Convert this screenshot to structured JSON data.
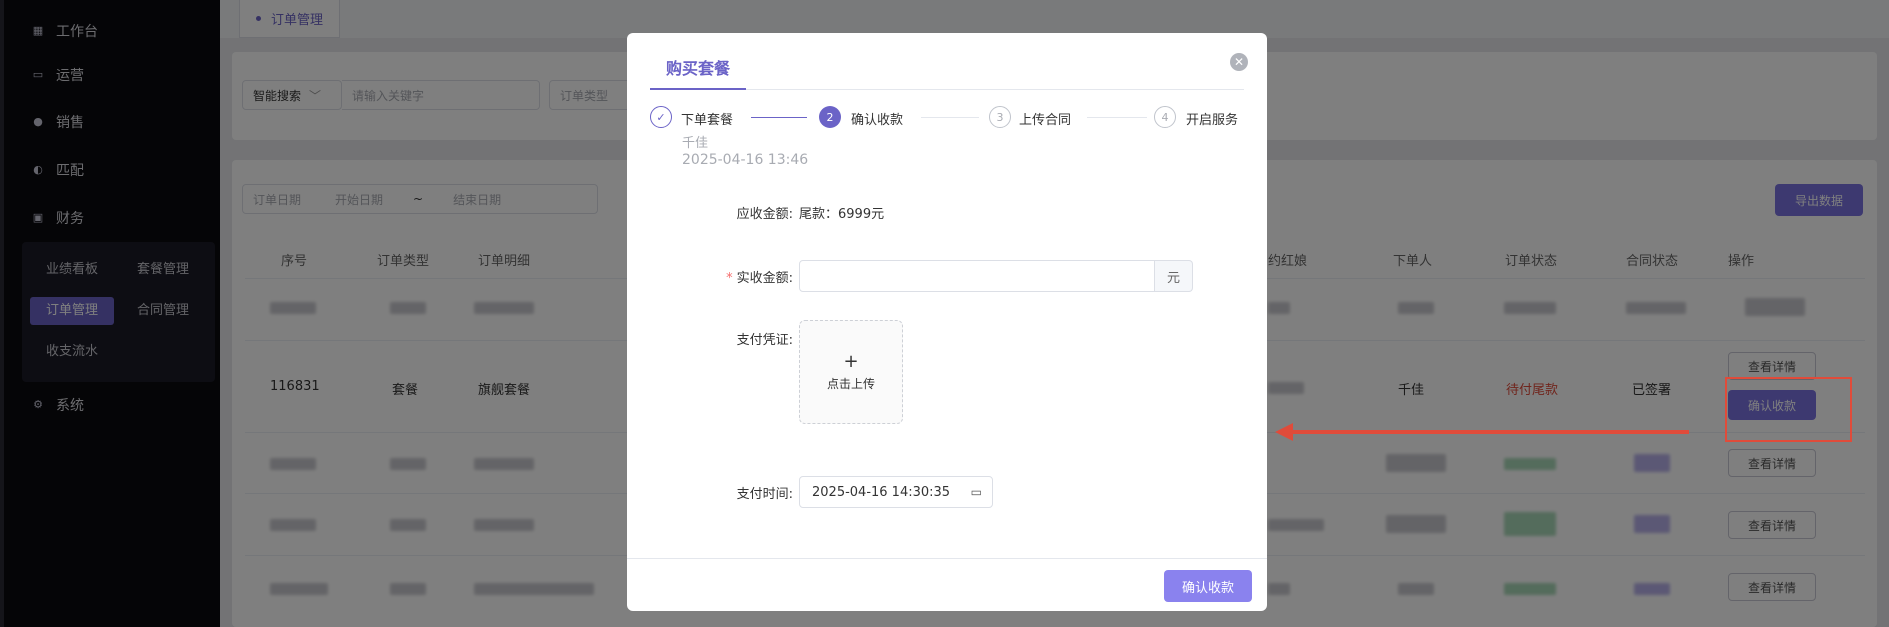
{
  "sidebar": {
    "items": [
      {
        "label": "工作台",
        "icon": "grid-icon"
      },
      {
        "label": "运营",
        "icon": "monitor-icon"
      },
      {
        "label": "销售",
        "icon": "user-icon"
      },
      {
        "label": "匹配",
        "icon": "match-icon"
      },
      {
        "label": "财务",
        "icon": "finance-icon"
      },
      {
        "label": "系统",
        "icon": "system-icon"
      }
    ],
    "sub_items": [
      {
        "label": "业绩看板"
      },
      {
        "label": "套餐管理"
      },
      {
        "label": "订单管理"
      },
      {
        "label": "合同管理"
      },
      {
        "label": "收支流水"
      }
    ]
  },
  "tabs": {
    "active_tab": "订单管理"
  },
  "search": {
    "smart_search_label": "智能搜索",
    "keyword_placeholder": "请输入关键字",
    "order_type_placeholder": "订单类型",
    "order_date_label": "订单日期",
    "start_date_placeholder": "开始日期",
    "date_separator": "~",
    "end_date_placeholder": "结束日期",
    "export_label": "导出数据"
  },
  "table": {
    "headers": [
      "序号",
      "订单类型",
      "订单明细",
      "约红娘",
      "下单人",
      "订单状态",
      "合同状态",
      "操作"
    ],
    "visible_row": {
      "id": "116831",
      "type": "套餐",
      "detail": "旗舰套餐",
      "orderer": "千佳",
      "order_status": "待付尾款",
      "contract_status": "已签署",
      "detail_button": "查看详情",
      "confirm_button": "确认收款"
    },
    "row_action_label": "查看详情",
    "status_color": "#e04b3a"
  },
  "modal": {
    "title": "购买套餐",
    "steps": [
      {
        "index": "✓",
        "label": "下单套餐",
        "state": "done"
      },
      {
        "index": "2",
        "label": "确认收款",
        "state": "active"
      },
      {
        "index": "3",
        "label": "上传合同",
        "state": "wait"
      },
      {
        "index": "4",
        "label": "开启服务",
        "state": "wait"
      }
    ],
    "step1_person": "千佳",
    "step1_time": "2025-04-16 13:46",
    "receivable_label": "应收金额:",
    "receivable_value": "尾款：6999元",
    "actual_label": "实收金额:",
    "actual_required_mark": "*",
    "actual_unit": "元",
    "voucher_label": "支付凭证:",
    "upload_plus": "+",
    "upload_text": "点击上传",
    "pay_time_label": "支付时间:",
    "pay_time_value": "2025-04-16 14:30:35",
    "submit_label": "确认收款",
    "accent_color": "#6b63c7"
  }
}
